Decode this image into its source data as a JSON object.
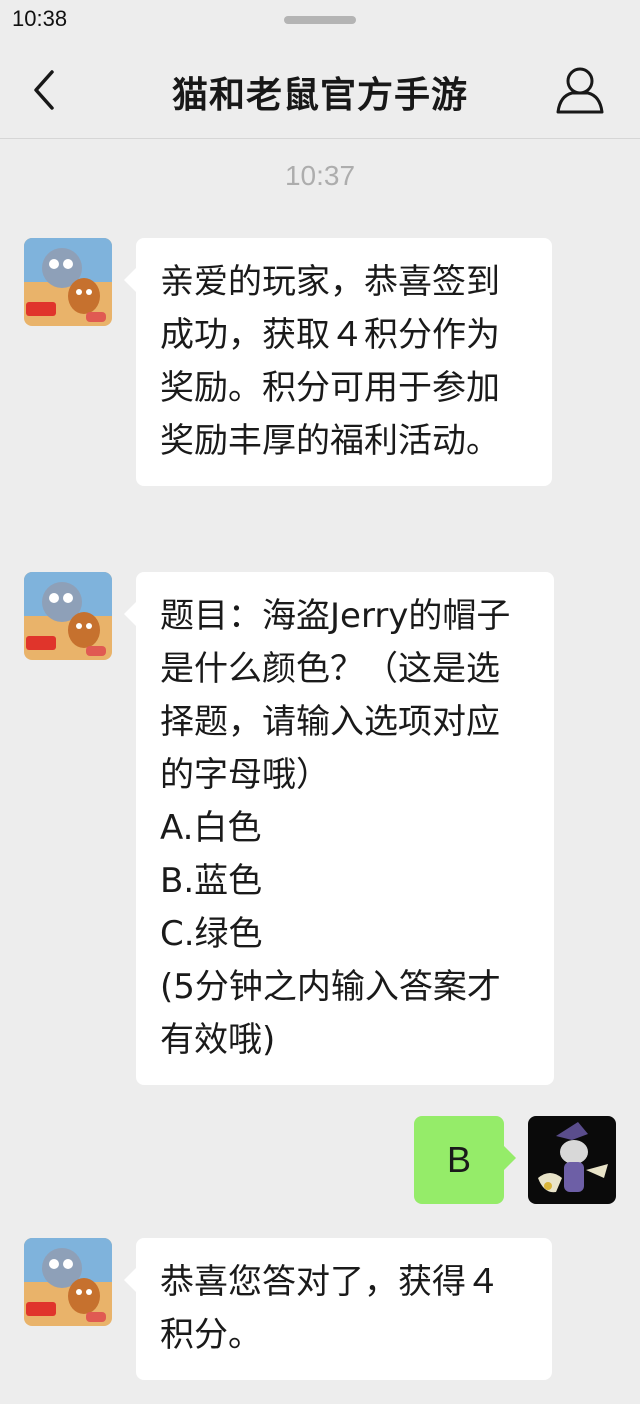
{
  "status_bar": {
    "time": "10:38"
  },
  "nav": {
    "title": "猫和老鼠官方手游",
    "back_icon": "chevron-left-icon",
    "profile_icon": "person-icon"
  },
  "chat": {
    "timestamp": "10:37",
    "messages": [
      {
        "sender": "official",
        "avatar_icon": "game-avatar-icon",
        "text": "亲爱的玩家，恭喜签到成功，获取４积分作为奖励。积分可用于参加奖励丰厚的福利活动。"
      },
      {
        "sender": "official",
        "avatar_icon": "game-avatar-icon",
        "text": "题目：海盗Jerry的帽子是什么颜色？（这是选择题，请输入选项对应的字母哦）\nA.白色\nB.蓝色\nC.绿色\n(5分钟之内输入答案才有效哦)"
      },
      {
        "sender": "me",
        "avatar_icon": "user-avatar-icon",
        "text": "B"
      },
      {
        "sender": "official",
        "avatar_icon": "game-avatar-icon",
        "text": "恭喜您答对了，获得４积分。"
      }
    ]
  },
  "colors": {
    "background": "#ededed",
    "incoming_bubble": "#ffffff",
    "outgoing_bubble": "#95ec69",
    "timestamp": "#adadad"
  }
}
